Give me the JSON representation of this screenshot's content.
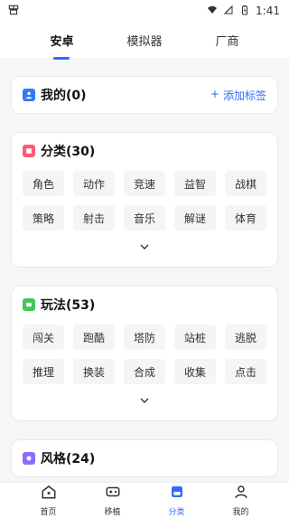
{
  "status": {
    "time": "1:41"
  },
  "tabs": [
    {
      "label": "安卓",
      "active": true
    },
    {
      "label": "模拟器",
      "active": false
    },
    {
      "label": "厂商",
      "active": false
    }
  ],
  "sections": {
    "mine": {
      "title": "我的(0)",
      "action": "添加标签",
      "icon_color": "#2f7bf6"
    },
    "category": {
      "title": "分类(30)",
      "icon_color": "#ff5a7a",
      "chips": [
        "角色",
        "动作",
        "竞速",
        "益智",
        "战棋",
        "策略",
        "射击",
        "音乐",
        "解谜",
        "体育"
      ]
    },
    "gameplay": {
      "title": "玩法(53)",
      "icon_color": "#42c55a",
      "chips": [
        "闯关",
        "跑酷",
        "塔防",
        "站桩",
        "逃脱",
        "推理",
        "换装",
        "合成",
        "收集",
        "点击"
      ]
    },
    "style": {
      "title": "风格(24)",
      "icon_color": "#8b6cff"
    }
  },
  "bottom_nav": [
    {
      "label": "首页",
      "icon": "home-icon",
      "active": false
    },
    {
      "label": "移植",
      "icon": "gamepad-icon",
      "active": false
    },
    {
      "label": "分类",
      "icon": "category-icon",
      "active": true
    },
    {
      "label": "我的",
      "icon": "person-icon",
      "active": false
    }
  ],
  "colors": {
    "accent": "#2f6bff"
  }
}
